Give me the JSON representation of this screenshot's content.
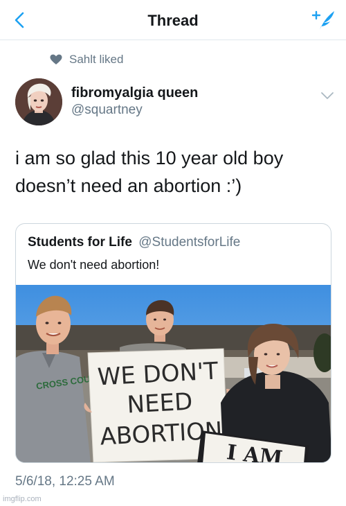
{
  "header": {
    "title": "Thread",
    "back_icon": "chevron-left-icon",
    "compose_icon": "compose-tweet-icon",
    "accent": "#1da1f2"
  },
  "social_context": {
    "text": "Sahlt liked",
    "icon": "heart-icon"
  },
  "tweet": {
    "display_name": "fibromyalgia queen",
    "handle": "@squartney",
    "text_line1": "i am so glad this 10 year old boy",
    "text_line2": "doesn’t need an abortion :’)",
    "timestamp": "5/6/18, 12:25 AM"
  },
  "quoted_tweet": {
    "name": "Students for Life",
    "handle": "@StudentsforLife",
    "text": "We don't need abortion!",
    "photo": {
      "sign_line1": "WE DON'T",
      "sign_line2": "NEED",
      "sign_line3": "ABORTION",
      "banner_text": "I AM",
      "hoodie_text": "CROSS COUNTRY"
    }
  },
  "watermark": "imgflip.com"
}
